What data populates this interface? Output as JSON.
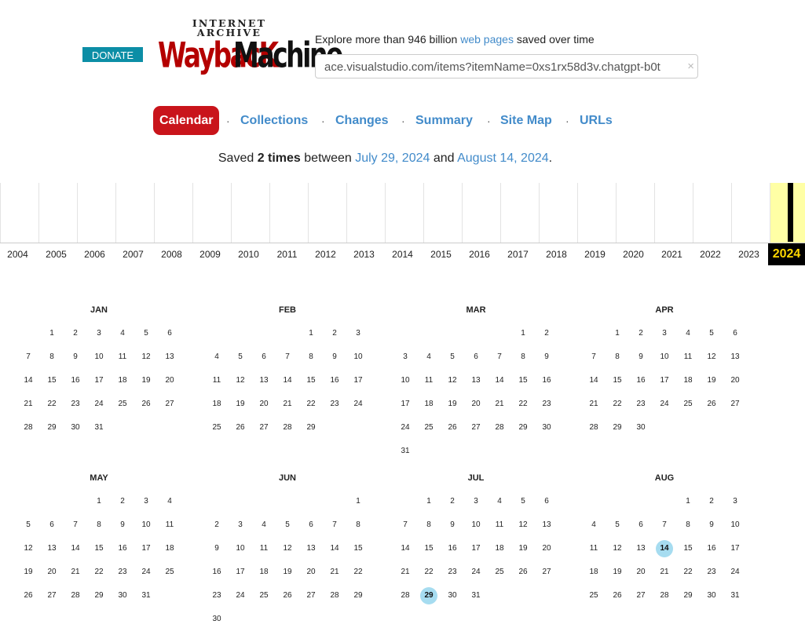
{
  "header": {
    "donate_label": "DONATE",
    "logo_top": "INTERNET ARCHIVE",
    "logo_wayback": "WaybacK",
    "logo_machine": "Machine",
    "tagline_pre": "Explore more than 946 billion ",
    "tagline_link": "web pages",
    "tagline_post": " saved over time",
    "url_value": "ace.visualstudio.com/items?itemName=0xs1rx58d3v.chatgpt-b0t",
    "clear_icon": "×"
  },
  "tabs": [
    "Calendar",
    "Collections",
    "Changes",
    "Summary",
    "Site Map",
    "URLs"
  ],
  "tab_separator": "·",
  "active_tab": "Calendar",
  "saved": {
    "pre": "Saved ",
    "count": "2 times",
    "mid": " between ",
    "start": "July 29, 2024",
    "and": " and ",
    "end": "August 14, 2024",
    "post": "."
  },
  "years": [
    "2004",
    "2005",
    "2006",
    "2007",
    "2008",
    "2009",
    "2010",
    "2011",
    "2012",
    "2013",
    "2014",
    "2015",
    "2016",
    "2017",
    "2018",
    "2019",
    "2020",
    "2021",
    "2022",
    "2023",
    "2024"
  ],
  "current_year": "2024",
  "months": [
    {
      "name": "JAN",
      "start": 1,
      "days": 31
    },
    {
      "name": "FEB",
      "start": 4,
      "days": 29
    },
    {
      "name": "MAR",
      "start": 5,
      "days": 31
    },
    {
      "name": "APR",
      "start": 1,
      "days": 30
    },
    {
      "name": "MAY",
      "start": 3,
      "days": 31
    },
    {
      "name": "JUN",
      "start": 6,
      "days": 30
    },
    {
      "name": "JUL",
      "start": 1,
      "days": 31
    },
    {
      "name": "AUG",
      "start": 4,
      "days": 31
    }
  ],
  "snapshots": [
    {
      "month": "JUL",
      "day": 29
    },
    {
      "month": "AUG",
      "day": 14
    }
  ],
  "colors": {
    "accent_link": "#428bca",
    "active_tab": "#c9141b",
    "donate": "#0c8ea6",
    "snapshot_day": "#a6dcf0",
    "current_year_bg": "#000000",
    "current_year_text": "#ffd700"
  }
}
